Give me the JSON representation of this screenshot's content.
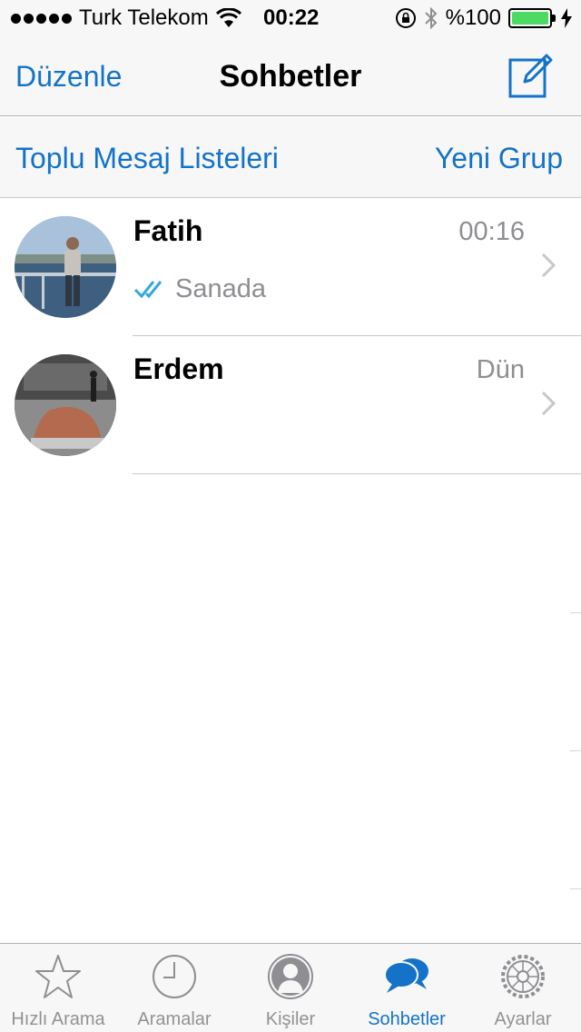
{
  "status_bar": {
    "carrier": "Turk Telekom",
    "time": "00:22",
    "battery_percent": "%100",
    "battery_level": 1.0,
    "icons": [
      "signal-dots-icon",
      "wifi-icon",
      "orientation-lock-icon",
      "bluetooth-icon",
      "battery-icon",
      "charging-bolt-icon"
    ]
  },
  "nav": {
    "edit_label": "Düzenle",
    "title": "Sohbetler",
    "compose_icon": "compose-icon"
  },
  "sub_bar": {
    "broadcast_label": "Toplu Mesaj Listeleri",
    "new_group_label": "Yeni Grup"
  },
  "chats": [
    {
      "name": "Fatih",
      "time": "00:16",
      "preview": "Sanada",
      "status_icon": "double-check-icon",
      "avatar_icon": "avatar-photo"
    },
    {
      "name": "Erdem",
      "time": "Dün",
      "preview": "",
      "avatar_icon": "avatar-photo"
    }
  ],
  "tabs": [
    {
      "label": "Hızlı Arama",
      "icon": "star-icon",
      "active": false
    },
    {
      "label": "Aramalar",
      "icon": "clock-icon",
      "active": false
    },
    {
      "label": "Kişiler",
      "icon": "person-icon",
      "active": false
    },
    {
      "label": "Sohbetler",
      "icon": "chat-bubbles-icon",
      "active": true
    },
    {
      "label": "Ayarlar",
      "icon": "gear-icon",
      "active": false
    }
  ],
  "colors": {
    "accent": "#1473c9",
    "secondary_text": "#8e8e93",
    "read_check": "#34aadc",
    "battery_fill": "#4cd964"
  }
}
